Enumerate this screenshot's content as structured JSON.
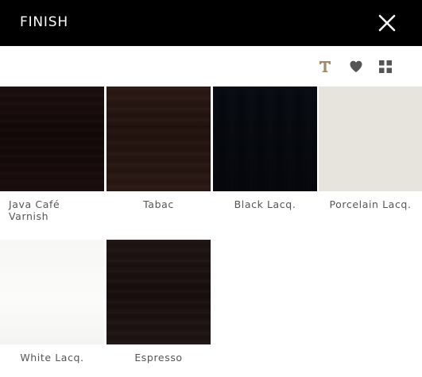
{
  "header": {
    "title": "FINISH",
    "close_icon": "close-icon"
  },
  "toolbar": {
    "items": [
      {
        "icon": "text-icon",
        "color": "#a08a6a"
      },
      {
        "icon": "heart-icon",
        "color": "#555555"
      },
      {
        "icon": "grid-icon",
        "color": "#555555"
      }
    ]
  },
  "swatches": [
    {
      "label": "Java Café Varnish"
    },
    {
      "label": "Tabac"
    },
    {
      "label": "Black Lacq."
    },
    {
      "label": "Porcelain Lacq."
    },
    {
      "label": "White Lacq."
    },
    {
      "label": "Espresso"
    }
  ],
  "colors": {
    "header_bg": "#000000",
    "header_text": "#ffffff",
    "label_text": "#555555",
    "accent_text_icon": "#a08a6a"
  }
}
